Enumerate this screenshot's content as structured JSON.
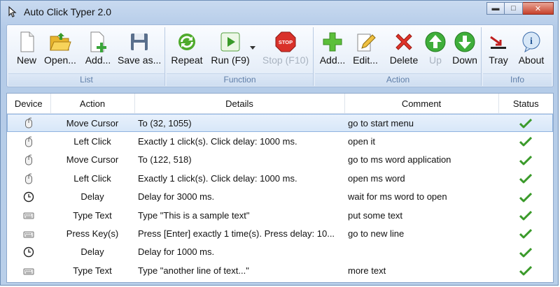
{
  "window": {
    "title": "Auto Click Typer 2.0",
    "minimize_glyph": "▬",
    "maximize_glyph": "□",
    "close_glyph": "✕"
  },
  "ribbon": {
    "groups": {
      "list": {
        "label": "List",
        "buttons": [
          "New",
          "Open...",
          "Add...",
          "Save as..."
        ]
      },
      "function": {
        "label": "Function",
        "buttons": [
          "Repeat",
          "Run (F9)",
          "Stop (F10)"
        ]
      },
      "action": {
        "label": "Action",
        "buttons": [
          "Add...",
          "Edit...",
          "Delete",
          "Up",
          "Down"
        ]
      },
      "info": {
        "label": "Info",
        "buttons": [
          "Tray",
          "About"
        ]
      }
    }
  },
  "table": {
    "headers": [
      "Device",
      "Action",
      "Details",
      "Comment",
      "Status"
    ],
    "rows": [
      {
        "device": "mouse-icon",
        "action": "Move Cursor",
        "details": "To (32, 1055)",
        "comment": "go to start menu",
        "status": "ok"
      },
      {
        "device": "mouse-icon",
        "action": "Left Click",
        "details": "Exactly 1 click(s). Click delay: 1000 ms.",
        "comment": "open it",
        "status": "ok"
      },
      {
        "device": "mouse-icon",
        "action": "Move Cursor",
        "details": "To (122, 518)",
        "comment": "go to ms word application",
        "status": "ok"
      },
      {
        "device": "mouse-icon",
        "action": "Left Click",
        "details": "Exactly 1 click(s). Click delay: 1000 ms.",
        "comment": "open ms word",
        "status": "ok"
      },
      {
        "device": "clock-icon",
        "action": "Delay",
        "details": "Delay for 3000 ms.",
        "comment": "wait for ms word to open",
        "status": "ok"
      },
      {
        "device": "keyboard-icon",
        "action": "Type Text",
        "details": "Type \"This is a sample text\"",
        "comment": "put some text",
        "status": "ok"
      },
      {
        "device": "keyboard-icon",
        "action": "Press Key(s)",
        "details": "Press [Enter] exactly 1 time(s). Press delay: 10...",
        "comment": "go to new line",
        "status": "ok"
      },
      {
        "device": "clock-icon",
        "action": "Delay",
        "details": "Delay for 1000 ms.",
        "comment": "",
        "status": "ok"
      },
      {
        "device": "keyboard-icon",
        "action": "Type Text",
        "details": "Type \"another line of text...\"",
        "comment": "more text",
        "status": "ok"
      }
    ]
  },
  "colors": {
    "accent": "#5f7ea8",
    "check_green": "#3a9a2a",
    "selection": "#d6e6f8"
  }
}
